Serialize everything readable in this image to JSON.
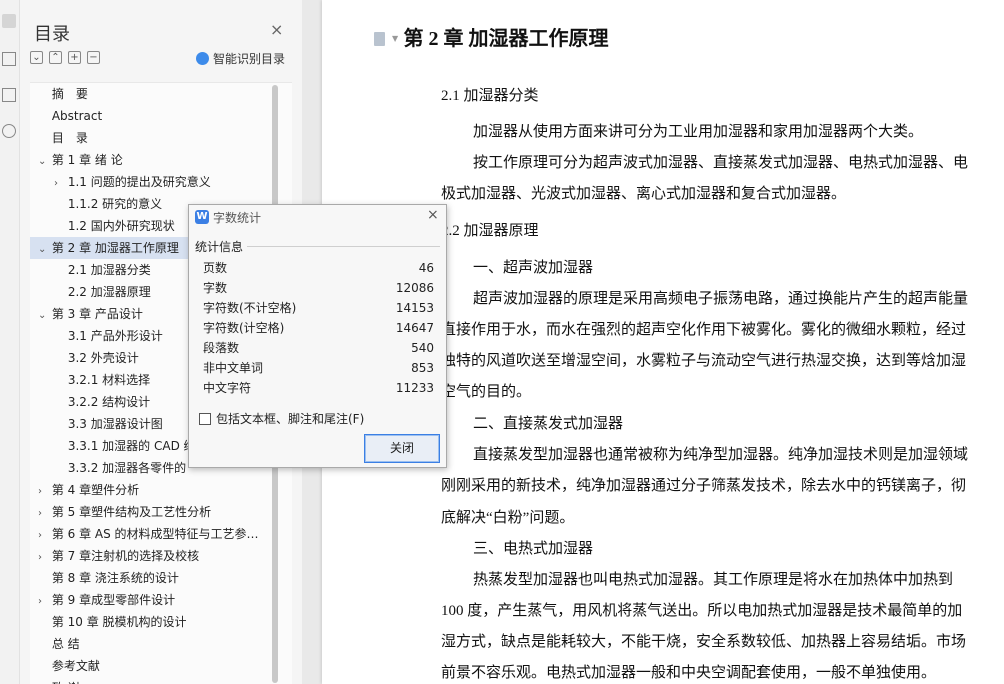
{
  "toc": {
    "title": "目录",
    "close_icon": "×",
    "tool_icons": [
      "⌄",
      "⌃",
      "+",
      "−"
    ],
    "smart_label": "智能识别目录",
    "items": [
      {
        "label": "摘　要",
        "level": 0,
        "caret": ""
      },
      {
        "label": "Abstract",
        "level": 0,
        "caret": ""
      },
      {
        "label": "目　录",
        "level": 0,
        "caret": ""
      },
      {
        "label": "第 1 章  绪  论",
        "level": 0,
        "caret": "⌄"
      },
      {
        "label": "1.1 问题的提出及研究意义",
        "level": 1,
        "caret": "›"
      },
      {
        "label": "1.1.2 研究的意义",
        "level": 1,
        "caret": ""
      },
      {
        "label": "1.2 国内外研究现状",
        "level": 1,
        "caret": ""
      },
      {
        "label": "第 2 章  加湿器工作原理",
        "level": 0,
        "caret": "⌄",
        "selected": true
      },
      {
        "label": "2.1 加湿器分类",
        "level": 1,
        "caret": ""
      },
      {
        "label": "2.2 加湿器原理",
        "level": 1,
        "caret": ""
      },
      {
        "label": "第 3 章  产品设计",
        "level": 0,
        "caret": "⌄"
      },
      {
        "label": "3.1  产品外形设计",
        "level": 1,
        "caret": ""
      },
      {
        "label": "3.2  外壳设计",
        "level": 1,
        "caret": ""
      },
      {
        "label": "3.2.1  材料选择",
        "level": 1,
        "caret": ""
      },
      {
        "label": "3.2.2  结构设计",
        "level": 1,
        "caret": ""
      },
      {
        "label": "3.3  加湿器设计图",
        "level": 1,
        "caret": ""
      },
      {
        "label": "3.3.1 加湿器的 CAD 绘",
        "level": 1,
        "caret": ""
      },
      {
        "label": "3.3.2 加湿器各零件的",
        "level": 1,
        "caret": ""
      },
      {
        "label": "第 4 章塑件分析",
        "level": 0,
        "caret": "›"
      },
      {
        "label": "第 5 章塑件结构及工艺性分析",
        "level": 0,
        "caret": "›"
      },
      {
        "label": "第 6 章  AS 的材料成型特征与工艺参…",
        "level": 0,
        "caret": "›"
      },
      {
        "label": "第 7 章注射机的选择及校核",
        "level": 0,
        "caret": "›"
      },
      {
        "label": "第 8 章  浇注系统的设计",
        "level": 0,
        "caret": ""
      },
      {
        "label": "第 9 章成型零部件设计",
        "level": 0,
        "caret": "›"
      },
      {
        "label": "第 10 章  脱模机构的设计",
        "level": 0,
        "caret": ""
      },
      {
        "label": "总  结",
        "level": 0,
        "caret": ""
      },
      {
        "label": "参考文献",
        "level": 0,
        "caret": ""
      },
      {
        "label": "致  谢",
        "level": 0,
        "caret": ""
      }
    ]
  },
  "document": {
    "chapter_title": "第 2 章  加湿器工作原理",
    "section_21": "2.1 加湿器分类",
    "section_22": "2.2 加湿器原理",
    "para1": "加湿器从使用方面来讲可分为工业用加湿器和家用加湿器两个大类。",
    "para2_l1": "按工作原理可分为超声波式加湿器、直接蒸发式加湿器、电热式加湿器、电",
    "para2_l2": "极式加湿器、光波式加湿器、离心式加湿器和复合式加湿器。",
    "sub1": "一、超声波加湿器",
    "para3_l1": "超声波加湿器的原理是采用高频电子振荡电路，通过换能片产生的超声能量",
    "para3_l2": "直接作用于水，而水在强烈的超声空化作用下被雾化。雾化的微细水颗粒，经过",
    "para3_l3": "独特的风道吹送至增湿空间，水雾粒子与流动空气进行热湿交换，达到等焓加湿",
    "para3_l4": "空气的目的。",
    "sub2": "二、直接蒸发式加湿器",
    "para4_l1": "直接蒸发型加湿器也通常被称为纯净型加湿器。纯净加湿技术则是加湿领域",
    "para4_l2": "刚刚采用的新技术，纯净加湿器通过分子筛蒸发技术，除去水中的钙镁离子，彻",
    "para4_l3": "底解决“白粉”问题。",
    "sub3": "三、电热式加湿器",
    "para5_l1": "热蒸发型加湿器也叫电热式加湿器。其工作原理是将水在加热体中加热到",
    "para5_l2": "100 度，产生蒸气，用风机将蒸气送出。所以电加热式加湿器是技术最简单的加",
    "para5_l3": "湿方式，缺点是能耗较大，不能干烧，安全系数较低、加热器上容易结垢。市场",
    "para5_l4": "前景不容乐观。电热式加湿器一般和中央空调配套使用，一般不单独使用。"
  },
  "dialog": {
    "logo": "W",
    "title": "字数统计",
    "close_icon": "×",
    "section": "统计信息",
    "stats": [
      {
        "label": "页数",
        "value": "46"
      },
      {
        "label": "字数",
        "value": "12086"
      },
      {
        "label": "字符数(不计空格)",
        "value": "14153"
      },
      {
        "label": "字符数(计空格)",
        "value": "14647"
      },
      {
        "label": "段落数",
        "value": "540"
      },
      {
        "label": "非中文单词",
        "value": "853"
      },
      {
        "label": "中文字符",
        "value": "11233"
      }
    ],
    "checkbox_label": "包括文本框、脚注和尾注(F)",
    "checkbox_checked": false,
    "close_button": "关闭"
  }
}
